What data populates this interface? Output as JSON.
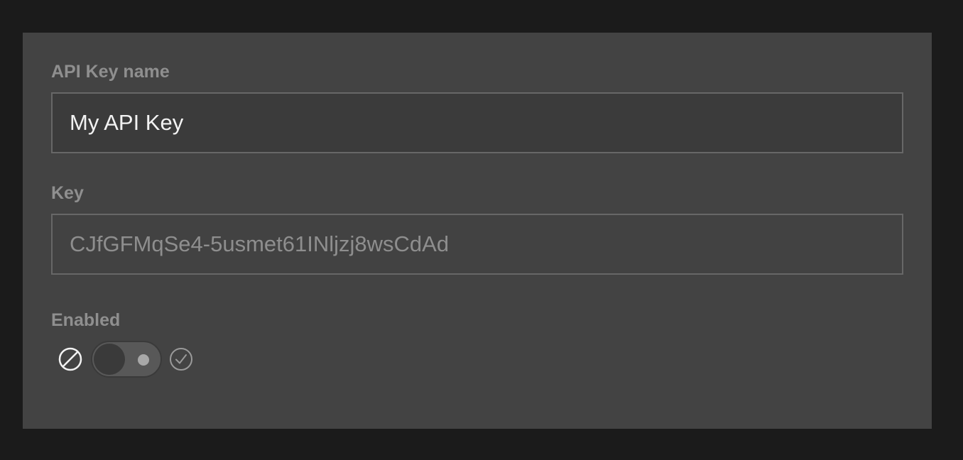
{
  "form": {
    "name_field": {
      "label": "API Key name",
      "value": "My API Key"
    },
    "key_field": {
      "label": "Key",
      "value": "CJfGFMqSe4-5usmet61INljzj8wsCdAd"
    },
    "enabled": {
      "label": "Enabled",
      "state": false,
      "off_icon": "disabled-circle-slash-icon",
      "on_icon": "checkmark-circle-icon"
    }
  },
  "colors": {
    "page_background": "#1b1b1b",
    "panel_background": "#434343",
    "label_text": "#8f8f8f",
    "input_text": "#f2f2f2",
    "readonly_text": "#8e8e8e",
    "input_border": "#676767"
  }
}
